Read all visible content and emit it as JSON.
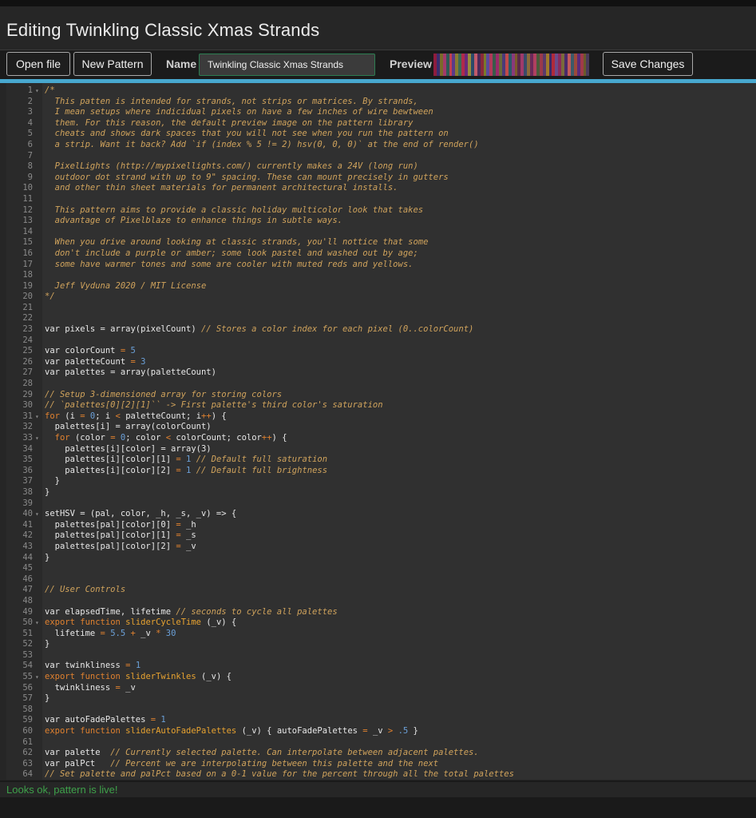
{
  "page": {
    "title": "Editing Twinkling Classic Xmas Strands"
  },
  "toolbar": {
    "open_label": "Open file",
    "new_label": "New Pattern",
    "name_label": "Name",
    "name_value": "Twinkling Classic Xmas Strands",
    "preview_label": "Preview",
    "save_label": "Save Changes",
    "preview_colors": [
      "#8e1d3d",
      "#3a2d6e",
      "#7a6a2a",
      "#a23a6a",
      "#2e5a55",
      "#c04050",
      "#5a3a8a",
      "#8a7a30",
      "#3a6a5a",
      "#b02a4a",
      "#6a2a7a",
      "#9a8a3a",
      "#2a4a6a",
      "#c05a6a",
      "#4a2a5a",
      "#8a2a3a",
      "#7a7a2a",
      "#5a4a9a",
      "#b03a5a",
      "#3a5a4a",
      "#9a2a6a",
      "#6a6a3a",
      "#4a3a7a",
      "#c04a4a",
      "#2a5a6a",
      "#8a3a7a",
      "#7a5a2a",
      "#5a2a4a",
      "#a03a6a",
      "#3a4a6a",
      "#8a6a3a",
      "#6a2a5a",
      "#b04060",
      "#4a5a3a",
      "#9a3a4a",
      "#5a3a6a",
      "#a07a2a",
      "#3a2a6a",
      "#b02a3a",
      "#6a4a8a",
      "#8a2a5a",
      "#7a6a3a",
      "#4a2a6a",
      "#c05a5a",
      "#3a5a6a",
      "#9a4a3a",
      "#5a2a7a",
      "#a03a4a",
      "#6a5a2a",
      "#4a3a5a"
    ]
  },
  "editor": {
    "lines": [
      {
        "n": "1",
        "f": true,
        "t": [
          [
            "c",
            "/*"
          ]
        ]
      },
      {
        "n": "2",
        "t": [
          [
            "c",
            "  This patten is intended for strands, not strips or matrices. By strands,"
          ]
        ]
      },
      {
        "n": "3",
        "t": [
          [
            "c",
            "  I mean setups where indicidual pixels on have a few inches of wire bewtween"
          ]
        ]
      },
      {
        "n": "4",
        "t": [
          [
            "c",
            "  them. For this reason, the default preview image on the pattern library"
          ]
        ]
      },
      {
        "n": "5",
        "t": [
          [
            "c",
            "  cheats and shows dark spaces that you will not see when you run the pattern on"
          ]
        ]
      },
      {
        "n": "6",
        "t": [
          [
            "c",
            "  a strip. Want it back? Add `if (index % 5 != 2) hsv(0, 0, 0)` at the end of render()"
          ]
        ]
      },
      {
        "n": "7",
        "t": []
      },
      {
        "n": "8",
        "t": [
          [
            "c",
            "  PixelLights (http://mypixellights.com/) currently makes a 24V (long run)"
          ]
        ]
      },
      {
        "n": "9",
        "t": [
          [
            "c",
            "  outdoor dot strand with up to 9\" spacing. These can mount precisely in gutters"
          ]
        ]
      },
      {
        "n": "10",
        "t": [
          [
            "c",
            "  and other thin sheet materials for permanent architectural installs."
          ]
        ]
      },
      {
        "n": "11",
        "t": []
      },
      {
        "n": "12",
        "t": [
          [
            "c",
            "  This pattern aims to provide a classic holiday multicolor look that takes"
          ]
        ]
      },
      {
        "n": "13",
        "t": [
          [
            "c",
            "  advantage of Pixelblaze to enhance things in subtle ways."
          ]
        ]
      },
      {
        "n": "14",
        "t": []
      },
      {
        "n": "15",
        "t": [
          [
            "c",
            "  When you drive around looking at classic strands, you'll nottice that some"
          ]
        ]
      },
      {
        "n": "16",
        "t": [
          [
            "c",
            "  don't include a purple or amber; some look pastel and washed out by age;"
          ]
        ]
      },
      {
        "n": "17",
        "t": [
          [
            "c",
            "  some have warmer tones and some are cooler with muted reds and yellows."
          ]
        ]
      },
      {
        "n": "18",
        "t": []
      },
      {
        "n": "19",
        "t": [
          [
            "c",
            "  Jeff Vyduna 2020 / MIT License"
          ]
        ]
      },
      {
        "n": "20",
        "t": [
          [
            "c",
            "*/"
          ]
        ]
      },
      {
        "n": "21",
        "t": []
      },
      {
        "n": "22",
        "t": []
      },
      {
        "n": "23",
        "t": [
          [
            "p",
            "var pixels = array(pixelCount) "
          ],
          [
            "c",
            "// Stores a color index for each pixel (0..colorCount)"
          ]
        ]
      },
      {
        "n": "24",
        "t": []
      },
      {
        "n": "25",
        "t": [
          [
            "p",
            "var colorCount "
          ],
          [
            "o",
            "="
          ],
          [
            "p",
            " "
          ],
          [
            "n",
            "5"
          ]
        ]
      },
      {
        "n": "26",
        "t": [
          [
            "p",
            "var paletteCount "
          ],
          [
            "o",
            "="
          ],
          [
            "p",
            " "
          ],
          [
            "n",
            "3"
          ]
        ]
      },
      {
        "n": "27",
        "t": [
          [
            "p",
            "var palettes = array(paletteCount)"
          ]
        ]
      },
      {
        "n": "28",
        "t": []
      },
      {
        "n": "29",
        "t": [
          [
            "c",
            "// Setup 3-dimensioned array for storing colors"
          ]
        ]
      },
      {
        "n": "30",
        "t": [
          [
            "c",
            "// `palettes[0][2][1]`` -> First palette's third color's saturation"
          ]
        ]
      },
      {
        "n": "31",
        "f": true,
        "t": [
          [
            "k",
            "for"
          ],
          [
            "p",
            " (i "
          ],
          [
            "o",
            "="
          ],
          [
            "p",
            " "
          ],
          [
            "n",
            "0"
          ],
          [
            "p",
            "; i "
          ],
          [
            "o",
            "<"
          ],
          [
            "p",
            " paletteCount; i"
          ],
          [
            "o",
            "++"
          ],
          [
            "p",
            ") {"
          ]
        ]
      },
      {
        "n": "32",
        "t": [
          [
            "p",
            "  palettes[i] = array(colorCount)"
          ]
        ]
      },
      {
        "n": "33",
        "f": true,
        "t": [
          [
            "p",
            "  "
          ],
          [
            "k",
            "for"
          ],
          [
            "p",
            " (color "
          ],
          [
            "o",
            "="
          ],
          [
            "p",
            " "
          ],
          [
            "n",
            "0"
          ],
          [
            "p",
            "; color "
          ],
          [
            "o",
            "<"
          ],
          [
            "p",
            " colorCount; color"
          ],
          [
            "o",
            "++"
          ],
          [
            "p",
            ") {"
          ]
        ]
      },
      {
        "n": "34",
        "t": [
          [
            "p",
            "    palettes[i][color] = array(3)"
          ]
        ]
      },
      {
        "n": "35",
        "t": [
          [
            "p",
            "    palettes[i][color][1] "
          ],
          [
            "o",
            "="
          ],
          [
            "p",
            " "
          ],
          [
            "n",
            "1"
          ],
          [
            "p",
            " "
          ],
          [
            "c",
            "// Default full saturation"
          ]
        ]
      },
      {
        "n": "36",
        "t": [
          [
            "p",
            "    palettes[i][color][2] "
          ],
          [
            "o",
            "="
          ],
          [
            "p",
            " "
          ],
          [
            "n",
            "1"
          ],
          [
            "p",
            " "
          ],
          [
            "c",
            "// Default full brightness"
          ]
        ]
      },
      {
        "n": "37",
        "t": [
          [
            "p",
            "  }"
          ]
        ]
      },
      {
        "n": "38",
        "t": [
          [
            "p",
            "}"
          ]
        ]
      },
      {
        "n": "39",
        "t": []
      },
      {
        "n": "40",
        "f": true,
        "t": [
          [
            "p",
            "setHSV = (pal, color, _h, _s, _v) => {"
          ]
        ]
      },
      {
        "n": "41",
        "t": [
          [
            "p",
            "  palettes[pal][color][0] "
          ],
          [
            "o",
            "="
          ],
          [
            "p",
            " _h"
          ]
        ]
      },
      {
        "n": "42",
        "t": [
          [
            "p",
            "  palettes[pal][color][1] "
          ],
          [
            "o",
            "="
          ],
          [
            "p",
            " _s"
          ]
        ]
      },
      {
        "n": "43",
        "t": [
          [
            "p",
            "  palettes[pal][color][2] "
          ],
          [
            "o",
            "="
          ],
          [
            "p",
            " _v"
          ]
        ]
      },
      {
        "n": "44",
        "t": [
          [
            "p",
            "}"
          ]
        ]
      },
      {
        "n": "45",
        "t": []
      },
      {
        "n": "46",
        "t": []
      },
      {
        "n": "47",
        "t": [
          [
            "c",
            "// User Controls"
          ]
        ]
      },
      {
        "n": "48",
        "t": []
      },
      {
        "n": "49",
        "t": [
          [
            "p",
            "var elapsedTime, lifetime "
          ],
          [
            "c",
            "// seconds to cycle all palettes"
          ]
        ]
      },
      {
        "n": "50",
        "f": true,
        "t": [
          [
            "k",
            "export"
          ],
          [
            "p",
            " "
          ],
          [
            "k",
            "function"
          ],
          [
            "p",
            " "
          ],
          [
            "fn",
            "sliderCycleTime"
          ],
          [
            "p",
            " (_v) {"
          ]
        ]
      },
      {
        "n": "51",
        "t": [
          [
            "p",
            "  lifetime "
          ],
          [
            "o",
            "="
          ],
          [
            "p",
            " "
          ],
          [
            "n",
            "5.5"
          ],
          [
            "p",
            " "
          ],
          [
            "o",
            "+"
          ],
          [
            "p",
            " _v "
          ],
          [
            "o",
            "*"
          ],
          [
            "p",
            " "
          ],
          [
            "n",
            "30"
          ]
        ]
      },
      {
        "n": "52",
        "t": [
          [
            "p",
            "}"
          ]
        ]
      },
      {
        "n": "53",
        "t": []
      },
      {
        "n": "54",
        "t": [
          [
            "p",
            "var twinkliness "
          ],
          [
            "o",
            "="
          ],
          [
            "p",
            " "
          ],
          [
            "n",
            "1"
          ]
        ]
      },
      {
        "n": "55",
        "f": true,
        "t": [
          [
            "k",
            "export"
          ],
          [
            "p",
            " "
          ],
          [
            "k",
            "function"
          ],
          [
            "p",
            " "
          ],
          [
            "fn",
            "sliderTwinkles"
          ],
          [
            "p",
            " (_v) {"
          ]
        ]
      },
      {
        "n": "56",
        "t": [
          [
            "p",
            "  twinkliness "
          ],
          [
            "o",
            "="
          ],
          [
            "p",
            " _v"
          ]
        ]
      },
      {
        "n": "57",
        "t": [
          [
            "p",
            "}"
          ]
        ]
      },
      {
        "n": "58",
        "t": []
      },
      {
        "n": "59",
        "t": [
          [
            "p",
            "var autoFadePalettes "
          ],
          [
            "o",
            "="
          ],
          [
            "p",
            " "
          ],
          [
            "n",
            "1"
          ]
        ]
      },
      {
        "n": "60",
        "t": [
          [
            "k",
            "export"
          ],
          [
            "p",
            " "
          ],
          [
            "k",
            "function"
          ],
          [
            "p",
            " "
          ],
          [
            "fn",
            "sliderAutoFadePalettes"
          ],
          [
            "p",
            " (_v) { autoFadePalettes "
          ],
          [
            "o",
            "="
          ],
          [
            "p",
            " _v "
          ],
          [
            "o",
            ">"
          ],
          [
            "p",
            " "
          ],
          [
            "n",
            ".5"
          ],
          [
            "p",
            " }"
          ]
        ]
      },
      {
        "n": "61",
        "t": []
      },
      {
        "n": "62",
        "t": [
          [
            "p",
            "var palette  "
          ],
          [
            "c",
            "// Currently selected palette. Can interpolate between adjacent palettes."
          ]
        ]
      },
      {
        "n": "63",
        "t": [
          [
            "p",
            "var palPct   "
          ],
          [
            "c",
            "// Percent we are interpolating between this palette and the next"
          ]
        ]
      },
      {
        "n": "64",
        "t": [
          [
            "c",
            "// Set palette and palPct based on a 0-1 value for the percent through all the total palettes"
          ]
        ]
      }
    ]
  },
  "status": {
    "message": "Looks ok, pattern is live!"
  }
}
